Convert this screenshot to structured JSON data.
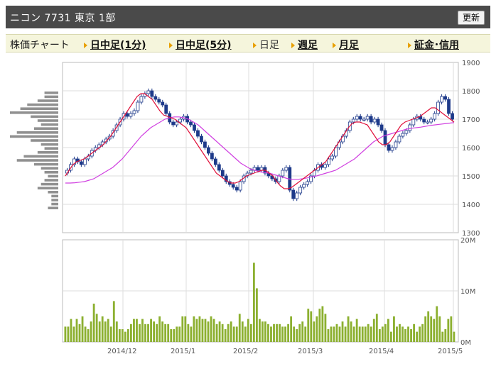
{
  "header": {
    "title": "ニコン  7731  東京 1部",
    "refresh_label": "更新"
  },
  "tabs": [
    {
      "label": "株価チャート",
      "style": "first"
    },
    {
      "label": "日中足(1分)",
      "style": "link"
    },
    {
      "label": "日中足(5分)",
      "style": "link"
    },
    {
      "label": "日足",
      "style": "plain"
    },
    {
      "label": "週足",
      "style": "link"
    },
    {
      "label": "月足",
      "style": "link"
    },
    {
      "label": "証金･信用",
      "style": "link"
    }
  ],
  "colors": {
    "candle": "#1e3a8a",
    "ma_short": "#e0103a",
    "ma_long": "#d040e0",
    "volume": "#8cb030",
    "volume_profile": "#909090"
  },
  "chart_data": [
    {
      "type": "candlestick",
      "title": "",
      "ylim": [
        1300,
        1900
      ],
      "y_ticks": [
        1300,
        1400,
        1500,
        1600,
        1700,
        1800,
        1900
      ],
      "x_tick_labels": [
        "2014/12",
        "2015/1",
        "2015/2",
        "2015/3",
        "2015/4",
        "2015/5"
      ],
      "close": [
        1520,
        1540,
        1560,
        1550,
        1540,
        1560,
        1570,
        1590,
        1600,
        1610,
        1620,
        1630,
        1640,
        1660,
        1680,
        1700,
        1720,
        1710,
        1720,
        1730,
        1760,
        1780,
        1790,
        1800,
        1780,
        1770,
        1760,
        1750,
        1720,
        1690,
        1680,
        1690,
        1700,
        1710,
        1690,
        1680,
        1660,
        1640,
        1620,
        1600,
        1580,
        1560,
        1540,
        1520,
        1500,
        1480,
        1470,
        1460,
        1450,
        1480,
        1500,
        1510,
        1520,
        1530,
        1520,
        1530,
        1510,
        1500,
        1490,
        1480,
        1500,
        1520,
        1530,
        1450,
        1420,
        1440,
        1460,
        1470,
        1480,
        1500,
        1520,
        1540,
        1530,
        1540,
        1560,
        1570,
        1600,
        1620,
        1640,
        1660,
        1690,
        1700,
        1710,
        1700,
        1700,
        1710,
        1690,
        1700,
        1680,
        1660,
        1610,
        1590,
        1600,
        1620,
        1640,
        1650,
        1660,
        1680,
        1700,
        1710,
        1700,
        1690,
        1690,
        1700,
        1720,
        1760,
        1780,
        1770,
        1720,
        1700
      ],
      "volume_profile_ylim": [
        1380,
        1800
      ],
      "volume_profile": [
        20,
        20,
        30,
        45,
        55,
        70,
        40,
        30,
        25,
        35,
        60,
        70,
        40,
        25,
        20,
        30,
        50,
        60,
        35,
        25,
        20,
        15,
        20,
        25,
        30,
        15,
        10,
        10,
        10,
        15
      ],
      "ma_short": [
        1500,
        1520,
        1540,
        1550,
        1555,
        1560,
        1570,
        1580,
        1590,
        1600,
        1610,
        1625,
        1640,
        1660,
        1680,
        1700,
        1720,
        1740,
        1760,
        1780,
        1790,
        1790,
        1780,
        1770,
        1750,
        1730,
        1715,
        1710,
        1705,
        1700,
        1690,
        1680,
        1670,
        1650,
        1630,
        1610,
        1590,
        1570,
        1550,
        1530,
        1510,
        1500,
        1490,
        1480,
        1475,
        1475,
        1480,
        1490,
        1500,
        1505,
        1510,
        1515,
        1520,
        1520,
        1510,
        1500,
        1480,
        1465,
        1455,
        1455,
        1460,
        1470,
        1480,
        1490,
        1500,
        1510,
        1520,
        1530,
        1540,
        1550,
        1570,
        1590,
        1610,
        1630,
        1650,
        1670,
        1685,
        1690,
        1690,
        1685,
        1680,
        1660,
        1640,
        1620,
        1610,
        1610,
        1620,
        1640,
        1660,
        1680,
        1690,
        1695,
        1700,
        1705,
        1710,
        1720,
        1730,
        1740,
        1740,
        1730,
        1720,
        1710,
        1700,
        1690
      ],
      "ma_long": [
        1475,
        1475,
        1476,
        1478,
        1480,
        1485,
        1490,
        1500,
        1510,
        1520,
        1530,
        1545,
        1560,
        1580,
        1600,
        1620,
        1640,
        1655,
        1670,
        1680,
        1690,
        1700,
        1705,
        1708,
        1708,
        1705,
        1700,
        1690,
        1680,
        1665,
        1650,
        1635,
        1620,
        1605,
        1590,
        1575,
        1560,
        1545,
        1535,
        1525,
        1520,
        1515,
        1512,
        1510,
        1505,
        1500,
        1495,
        1490,
        1488,
        1488,
        1490,
        1493,
        1497,
        1500,
        1505,
        1510,
        1515,
        1520,
        1530,
        1540,
        1550,
        1560,
        1575,
        1590,
        1605,
        1620,
        1630,
        1640,
        1645,
        1650,
        1655,
        1660,
        1665,
        1668,
        1670,
        1672,
        1675,
        1678,
        1680,
        1682,
        1684,
        1686,
        1688
      ],
      "volume_ylim": [
        0,
        20
      ],
      "volume_ticks": [
        "0M",
        "10M",
        "20M"
      ],
      "volume": [
        3,
        3,
        4.5,
        3,
        4.5,
        3.5,
        5,
        3,
        2.5,
        4,
        7.5,
        5.5,
        4,
        5,
        4,
        4.5,
        3,
        8,
        4,
        2.5,
        2.5,
        2,
        2.5,
        3.5,
        4.5,
        4.5,
        3.5,
        4.5,
        3.5,
        3.5,
        4.5,
        4,
        3.5,
        5,
        4,
        3.5,
        3.5,
        2.5,
        2.5,
        3,
        3,
        5,
        5,
        3.5,
        3,
        5,
        4.5,
        5,
        4.5,
        4.5,
        4,
        5,
        4.5,
        3.5,
        4,
        3.5,
        2.5,
        3.5,
        4,
        3,
        3,
        5.5,
        4,
        3,
        4.5,
        3.5,
        15.5,
        10.5,
        4.5,
        4,
        4,
        3.5,
        3,
        3.5,
        3.5,
        3.5,
        3,
        3,
        3.5,
        5,
        3,
        2.5,
        3.5,
        4,
        3,
        6.5,
        6,
        4,
        5,
        6.5,
        7,
        5.5,
        2.5,
        3,
        3,
        3.5,
        3,
        4,
        3,
        5,
        4,
        3,
        4.5,
        3,
        3,
        3,
        3.5,
        3,
        4.5,
        5.5,
        2.5,
        3,
        3.5,
        4.5,
        2,
        5,
        3,
        3.5,
        3,
        2.5,
        3,
        2.5,
        3.5,
        2,
        3,
        3.5,
        5,
        6,
        5,
        4.5,
        7,
        5,
        2,
        2.5,
        4.5,
        5,
        2
      ]
    }
  ]
}
